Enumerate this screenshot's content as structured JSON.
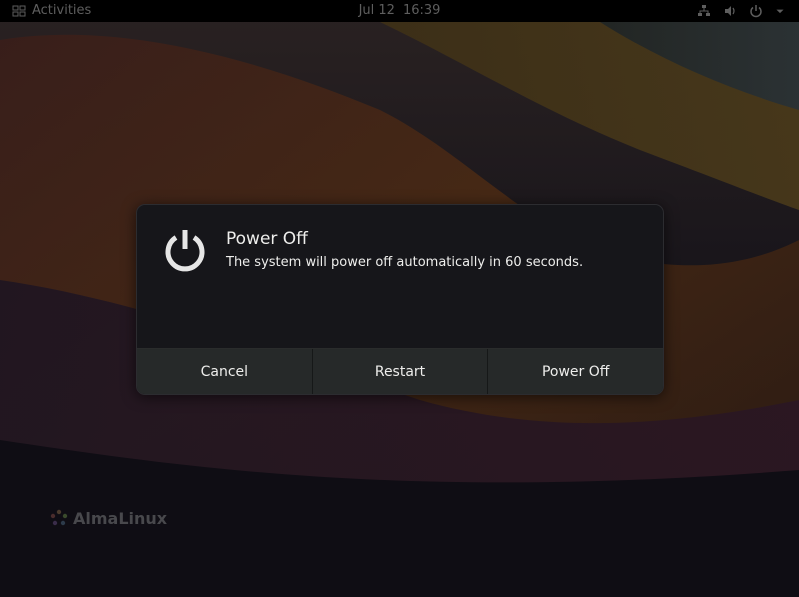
{
  "topbar": {
    "activities_label": "Activities",
    "date": "Jul 12",
    "time": "16:39",
    "tray_icons": [
      "network-icon",
      "volume-icon",
      "power-icon",
      "chevron-down-icon"
    ]
  },
  "dialog": {
    "title": "Power Off",
    "message": "The system will power off automatically in 60 seconds.",
    "icon": "power-icon",
    "buttons": {
      "cancel": "Cancel",
      "restart": "Restart",
      "power_off": "Power Off"
    }
  },
  "desktop": {
    "brand_name": "AlmaLinux"
  },
  "colors": {
    "topbar_bg": "#000000",
    "dialog_bg": "#16161a",
    "button_bg": "#262929",
    "text": "#eeeeec"
  }
}
